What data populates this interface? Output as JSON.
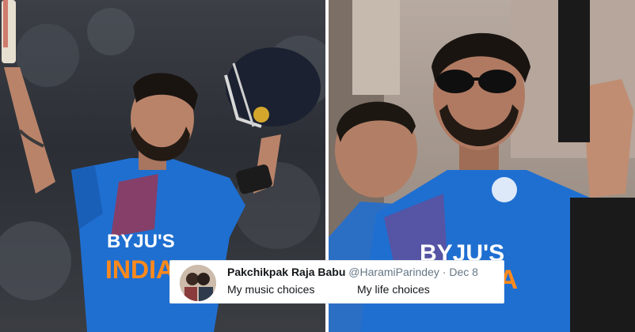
{
  "photos": {
    "left": {
      "jersey_text": [
        "BYJU'S",
        "INDIA"
      ]
    },
    "right": {
      "jersey_text": [
        "BYJU'S",
        "IA"
      ]
    }
  },
  "tweet": {
    "display_name": "Pakchikpak Raja Babu",
    "handle": "@HaramiParindey",
    "separator": "·",
    "date": "Dec 8",
    "caption_left": "My music choices",
    "caption_right": "My life choices"
  },
  "colors": {
    "jersey_blue": "#1f6fd1",
    "jersey_orange": "#ff8a1c",
    "tweet_name": "#14171a",
    "tweet_meta": "#657786"
  }
}
